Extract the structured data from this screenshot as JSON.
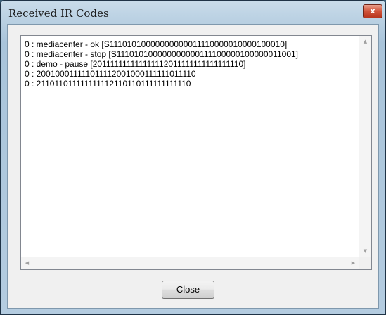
{
  "window": {
    "title": "Received IR Codes",
    "close_glyph": "x"
  },
  "codes": [
    "0 : mediacenter - ok [S11101010000000000011110000010000100010]",
    "0 : mediacenter - stop [S111010100000000000111100000100000011001]",
    "0 : demo - pause [201111111111111112011111111111111110]",
    "0 : 200100011111011112001000111111011110",
    "0 : 211011011111111112110110111111111110"
  ],
  "scrollbars": {
    "up_icon": "chevron-up-icon",
    "down_icon": "chevron-down-icon",
    "left_icon": "chevron-left-icon",
    "right_icon": "chevron-right-icon"
  },
  "buttons": {
    "close_label": "Close"
  },
  "colors": {
    "title_close_red": "#c8452c",
    "frame_blue": "#b9d0e2"
  }
}
